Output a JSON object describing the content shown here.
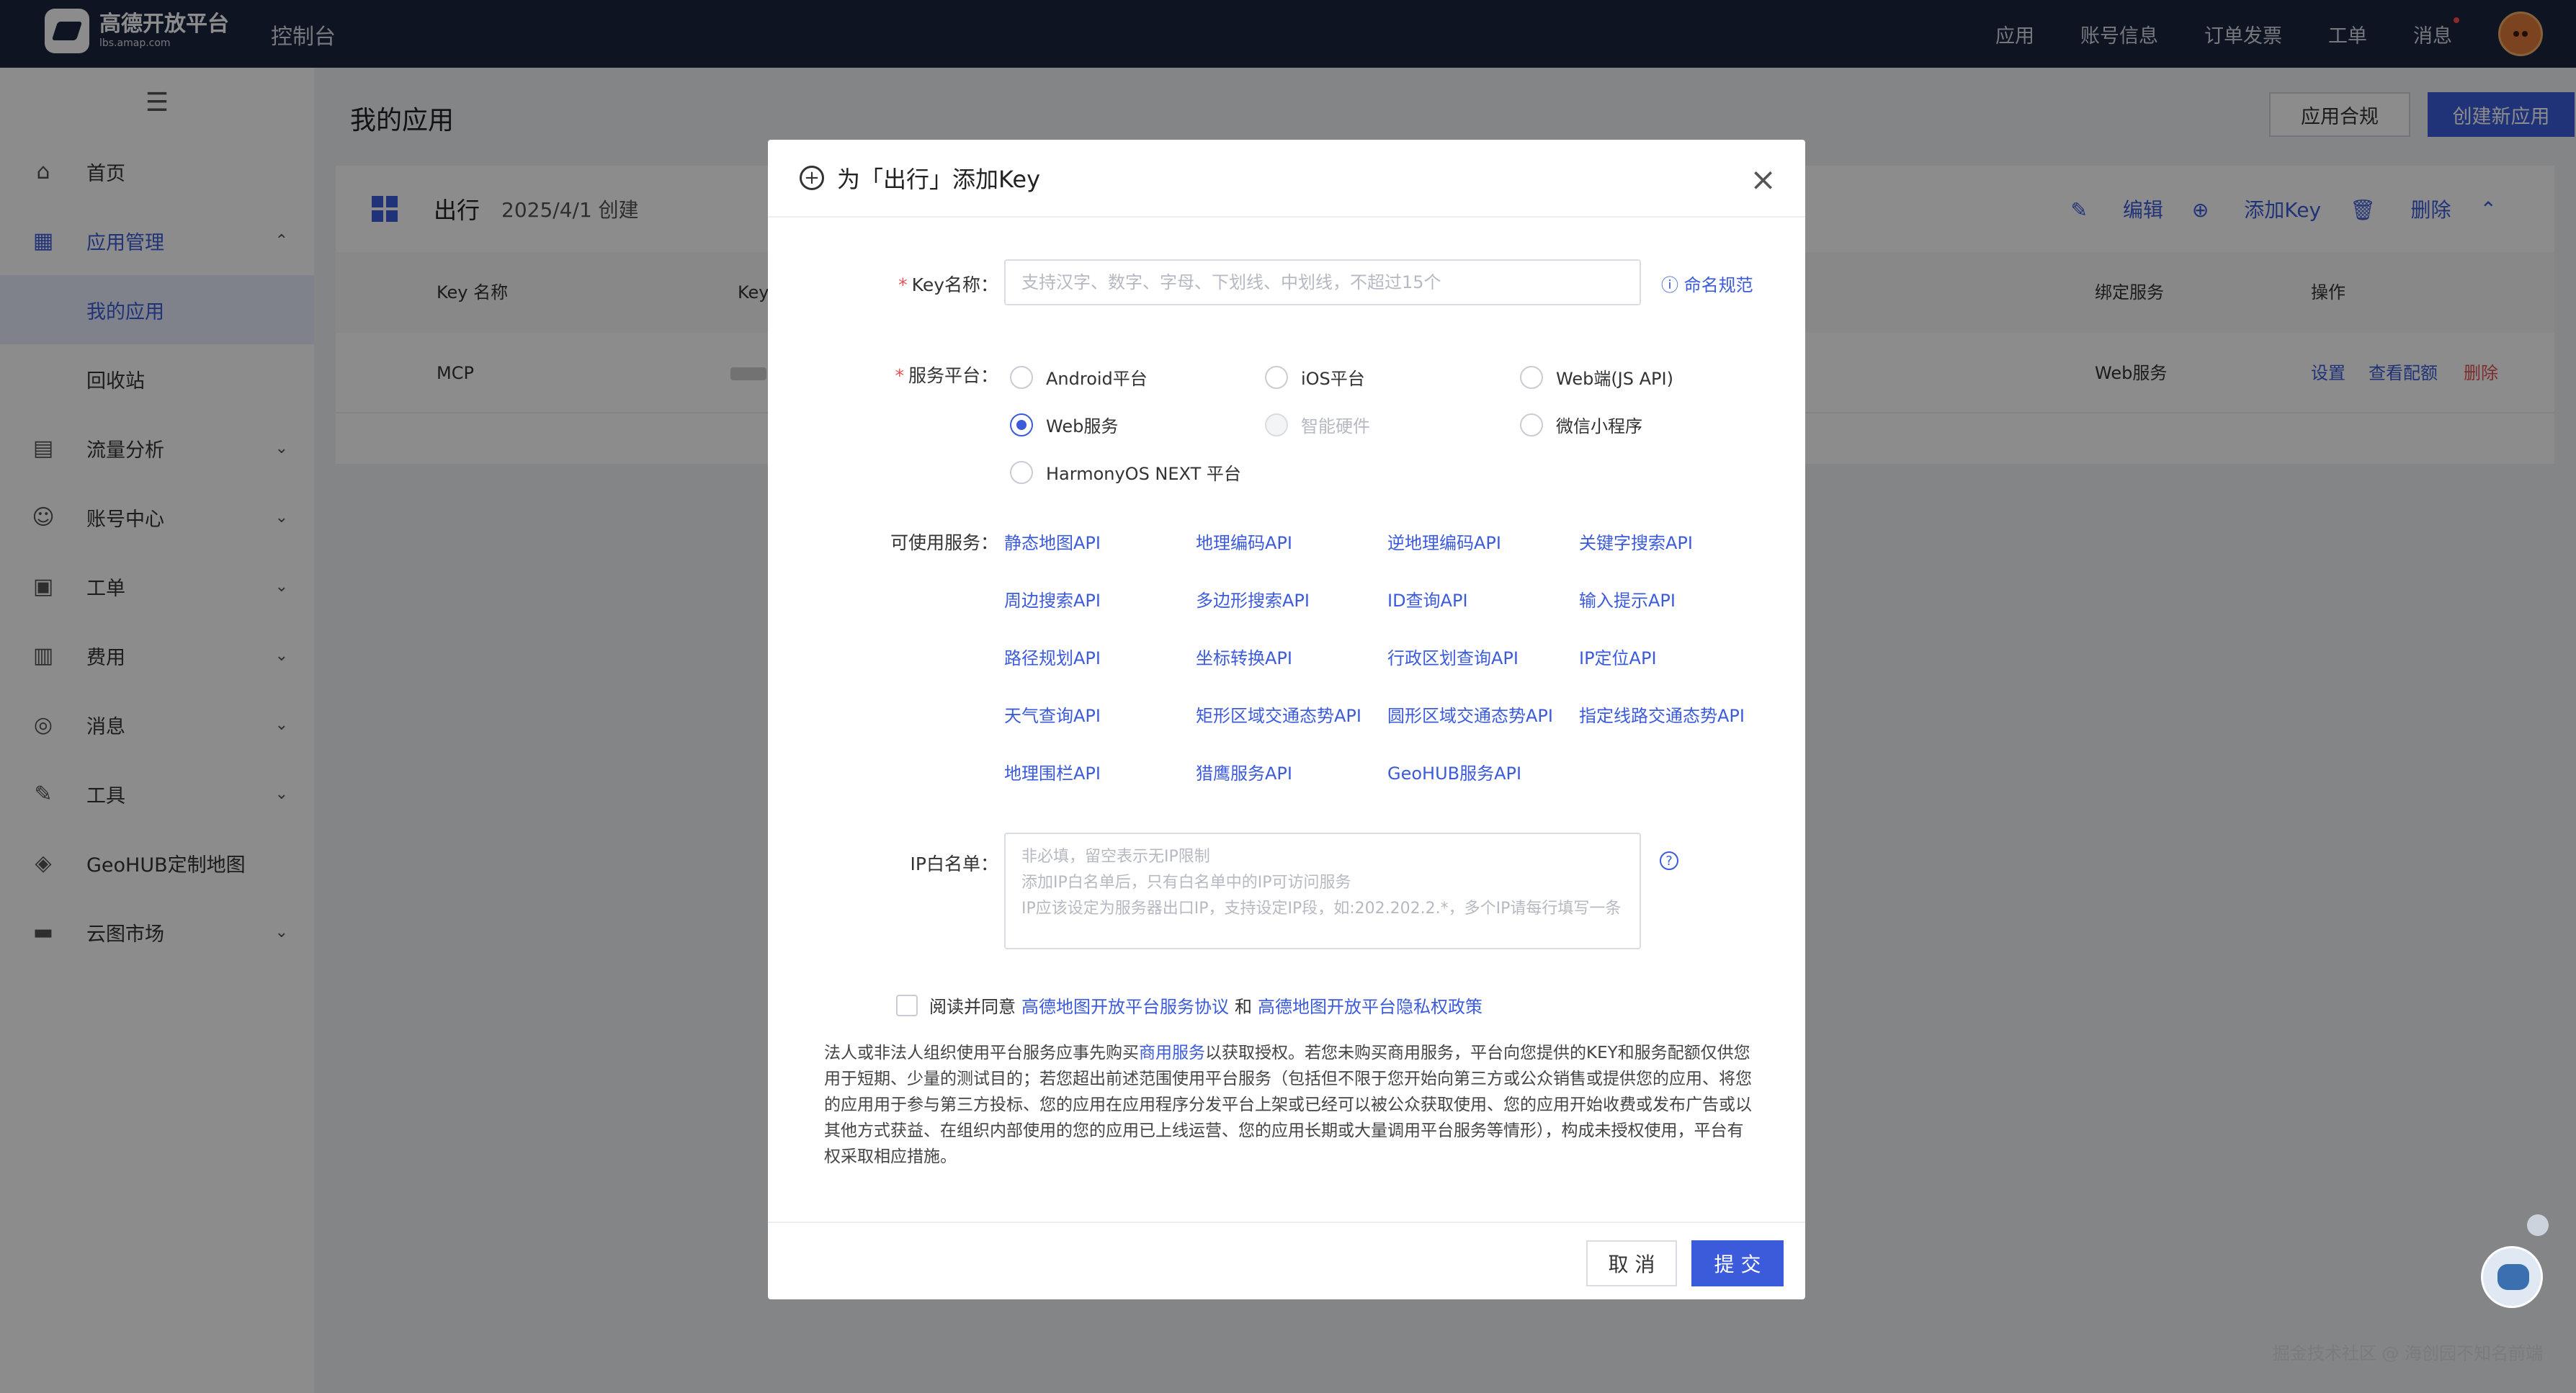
{
  "topbar": {
    "logo_title": "高德开放平台",
    "logo_sub": "lbs.amap.com",
    "console": "控制台",
    "nav": [
      "应用",
      "账号信息",
      "订单发票",
      "工单",
      "消息"
    ]
  },
  "sidebar": {
    "items": [
      {
        "label": "首页",
        "icon": "home-icon"
      },
      {
        "label": "应用管理",
        "icon": "apps-icon"
      },
      {
        "label": "流量分析",
        "icon": "chart-icon"
      },
      {
        "label": "账号中心",
        "icon": "user-icon"
      },
      {
        "label": "工单",
        "icon": "ticket-icon"
      },
      {
        "label": "费用",
        "icon": "billing-icon"
      },
      {
        "label": "消息",
        "icon": "message-icon"
      },
      {
        "label": "工具",
        "icon": "wrench-icon"
      },
      {
        "label": "GeoHUB定制地图",
        "icon": "layers-icon"
      },
      {
        "label": "云图市场",
        "icon": "store-icon"
      }
    ],
    "sub": [
      "我的应用",
      "回收站"
    ]
  },
  "main": {
    "title": "我的应用",
    "compliance_btn": "应用合规",
    "create_btn": "创建新应用",
    "app": {
      "name": "出行",
      "created": "2025/4/1 创建",
      "actions": [
        "编辑",
        "添加Key",
        "删除"
      ],
      "columns": [
        "Key 名称",
        "Key",
        "绑定服务",
        "操作"
      ],
      "row": {
        "name": "MCP",
        "service": "Web服务",
        "ops": [
          "设置",
          "查看配额",
          "删除"
        ]
      }
    }
  },
  "modal": {
    "title": "为「出行」添加Key",
    "key_label": "Key名称：",
    "key_placeholder": "支持汉字、数字、字母、下划线、中划线，不超过15个",
    "naming_link": "命名规范",
    "platform_label": "服务平台：",
    "platforms": [
      {
        "label": "Android平台",
        "state": "normal"
      },
      {
        "label": "iOS平台",
        "state": "normal"
      },
      {
        "label": "Web端(JS API)",
        "state": "normal"
      },
      {
        "label": "Web服务",
        "state": "checked"
      },
      {
        "label": "智能硬件",
        "state": "disabled"
      },
      {
        "label": "微信小程序",
        "state": "normal"
      },
      {
        "label": "HarmonyOS NEXT 平台",
        "state": "normal"
      }
    ],
    "services_label": "可使用服务：",
    "services": [
      "静态地图API",
      "地理编码API",
      "逆地理编码API",
      "关键字搜索API",
      "周边搜索API",
      "多边形搜索API",
      "ID查询API",
      "输入提示API",
      "路径规划API",
      "坐标转换API",
      "行政区划查询API",
      "IP定位API",
      "天气查询API",
      "矩形区域交通态势API",
      "圆形区域交通态势API",
      "指定线路交通态势API",
      "地理围栏API",
      "猎鹰服务API",
      "GeoHUB服务API"
    ],
    "ip_label": "IP白名单：",
    "ip_placeholder": "非必填，留空表示无IP限制\n添加IP白名单后，只有白名单中的IP可访问服务\nIP应该设定为服务器出口IP，支持设定IP段，如:202.202.2.*，多个IP请每行填写一条",
    "agree_prefix": "阅读并同意",
    "agree_link1": "高德地图开放平台服务协议",
    "agree_and": "和",
    "agree_link2": "高德地图开放平台隐私权政策",
    "notice_pre": "法人或非法人组织使用平台服务应事先购买",
    "notice_link": "商用服务",
    "notice_post": "以获取授权。若您未购买商用服务，平台向您提供的KEY和服务配额仅供您用于短期、少量的测试目的；若您超出前述范围使用平台服务（包括但不限于您开始向第三方或公众销售或提供您的应用、将您的应用用于参与第三方投标、您的应用在应用程序分发平台上架或已经可以被公众获取使用、您的应用开始收费或发布广告或以其他方式获益、在组织内部使用的您的应用已上线运营、您的应用长期或大量调用平台服务等情形），构成未授权使用，平台有权采取相应措施。",
    "cancel": "取 消",
    "submit": "提 交"
  },
  "watermark": "掘金技术社区 @ 海创园不知名前端"
}
